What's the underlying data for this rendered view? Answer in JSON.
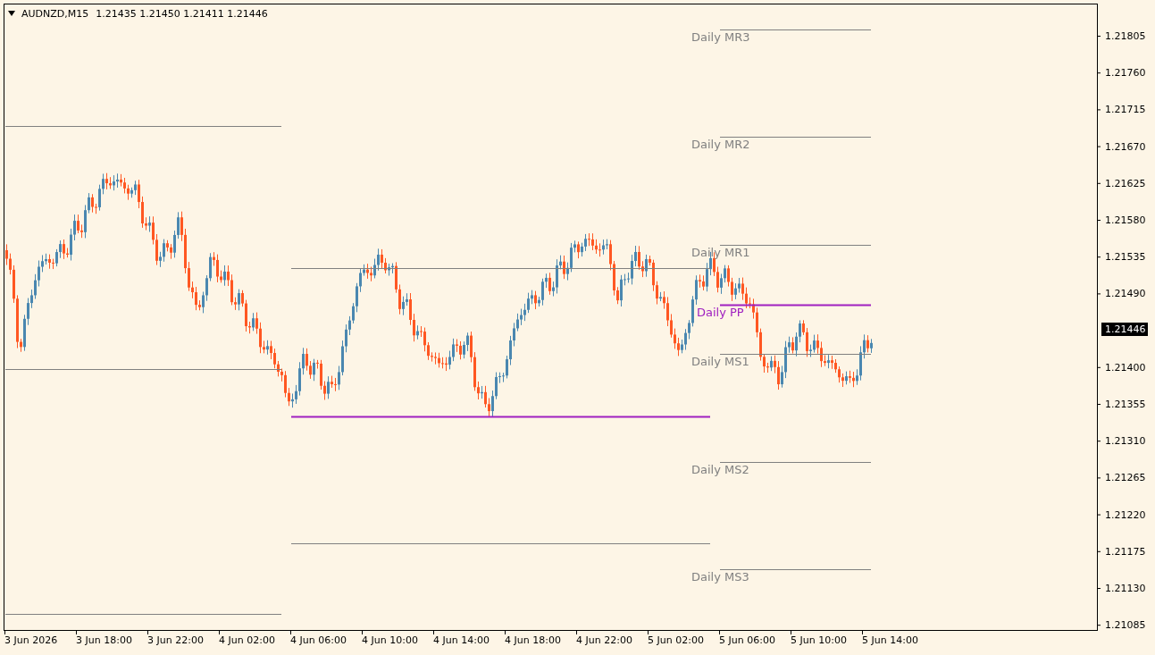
{
  "chart_header": {
    "symbol": "AUDNZD,M15",
    "quote": "1.21435 1.21450 1.21411 1.21446"
  },
  "pivot_labels": [
    {
      "text": "Daily MR3",
      "kind": "resistance"
    },
    {
      "text": "Daily MR2",
      "kind": "resistance"
    },
    {
      "text": "Daily MR1",
      "kind": "resistance"
    },
    {
      "text": "Daily PP",
      "kind": "pivot"
    },
    {
      "text": "Daily MS1",
      "kind": "support"
    },
    {
      "text": "Daily MS2",
      "kind": "support"
    },
    {
      "text": "Daily MS3",
      "kind": "support"
    }
  ],
  "price_axis": {
    "ticks": [
      "1.21805",
      "1.21760",
      "1.21715",
      "1.21670",
      "1.21625",
      "1.21580",
      "1.21535",
      "1.21490",
      "1.21400",
      "1.21355",
      "1.21310",
      "1.21265",
      "1.21220",
      "1.21175",
      "1.21130",
      "1.21085"
    ],
    "current_price": "1.21446"
  },
  "time_axis": {
    "ticks": [
      "3 Jun 2026",
      "3 Jun 18:00",
      "3 Jun 22:00",
      "4 Jun 02:00",
      "4 Jun 06:00",
      "4 Jun 10:00",
      "4 Jun 14:00",
      "4 Jun 18:00",
      "4 Jun 22:00",
      "5 Jun 02:00",
      "5 Jun 06:00",
      "5 Jun 10:00",
      "5 Jun 14:00"
    ]
  }
}
